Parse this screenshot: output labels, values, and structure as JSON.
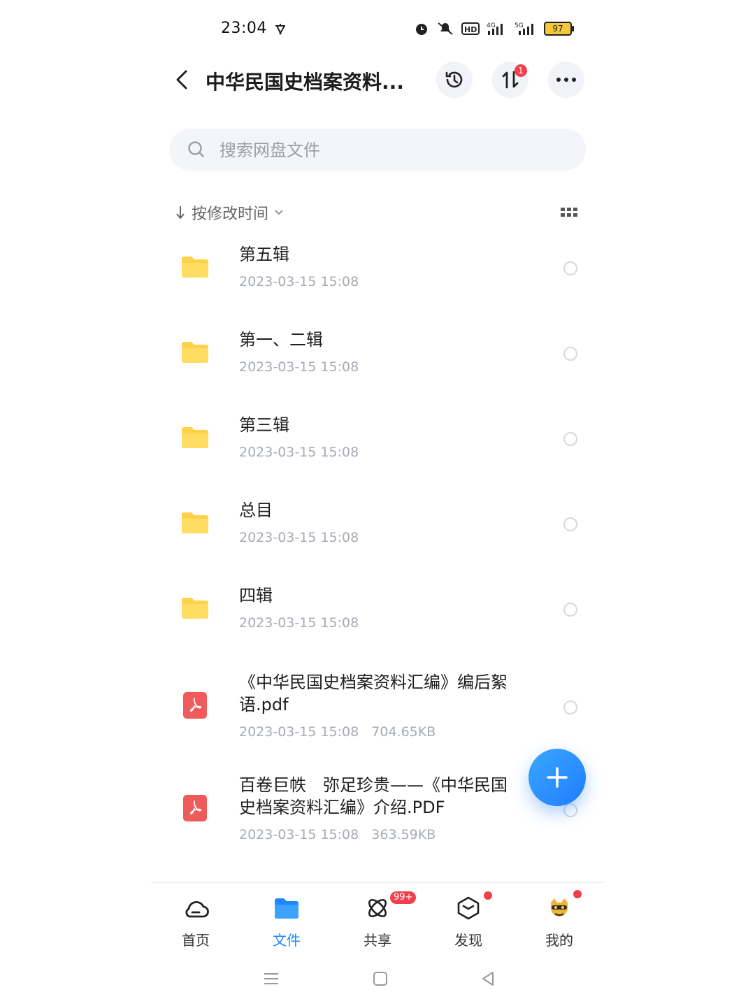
{
  "status": {
    "time": "23:04",
    "battery": "97"
  },
  "header": {
    "title": "中华民国史档案资料...",
    "transfer_badge": "1"
  },
  "search": {
    "placeholder": "搜索网盘文件"
  },
  "sort": {
    "label": "按修改时间"
  },
  "files": [
    {
      "name": "第五辑",
      "date": "2023-03-15  15:08",
      "size": "",
      "type": "folder"
    },
    {
      "name": "第一、二辑",
      "date": "2023-03-15  15:08",
      "size": "",
      "type": "folder"
    },
    {
      "name": "第三辑",
      "date": "2023-03-15  15:08",
      "size": "",
      "type": "folder"
    },
    {
      "name": "总目",
      "date": "2023-03-15  15:08",
      "size": "",
      "type": "folder"
    },
    {
      "name": "四辑",
      "date": "2023-03-15  15:08",
      "size": "",
      "type": "folder"
    },
    {
      "name_line1": "《中华民国史档案资料汇编》编后絮",
      "name_line2": "语.pdf",
      "date": "2023-03-15  15:08",
      "size": "704.65KB",
      "type": "pdf"
    },
    {
      "name_line1": "百卷巨帙　弥足珍贵——《中华民国",
      "name_line2": "史档案资料汇编》介绍.PDF",
      "date": "2023-03-15  15:08",
      "size": "363.59KB",
      "type": "pdf"
    }
  ],
  "nav": {
    "home": "首页",
    "files": "文件",
    "share": "共享",
    "share_badge": "99+",
    "discover": "发现",
    "mine": "我的"
  },
  "colors": {
    "accent": "#1e88ff",
    "folder": "#ffd24a",
    "pdf": "#ef5a5a",
    "badge": "#f1404b"
  }
}
